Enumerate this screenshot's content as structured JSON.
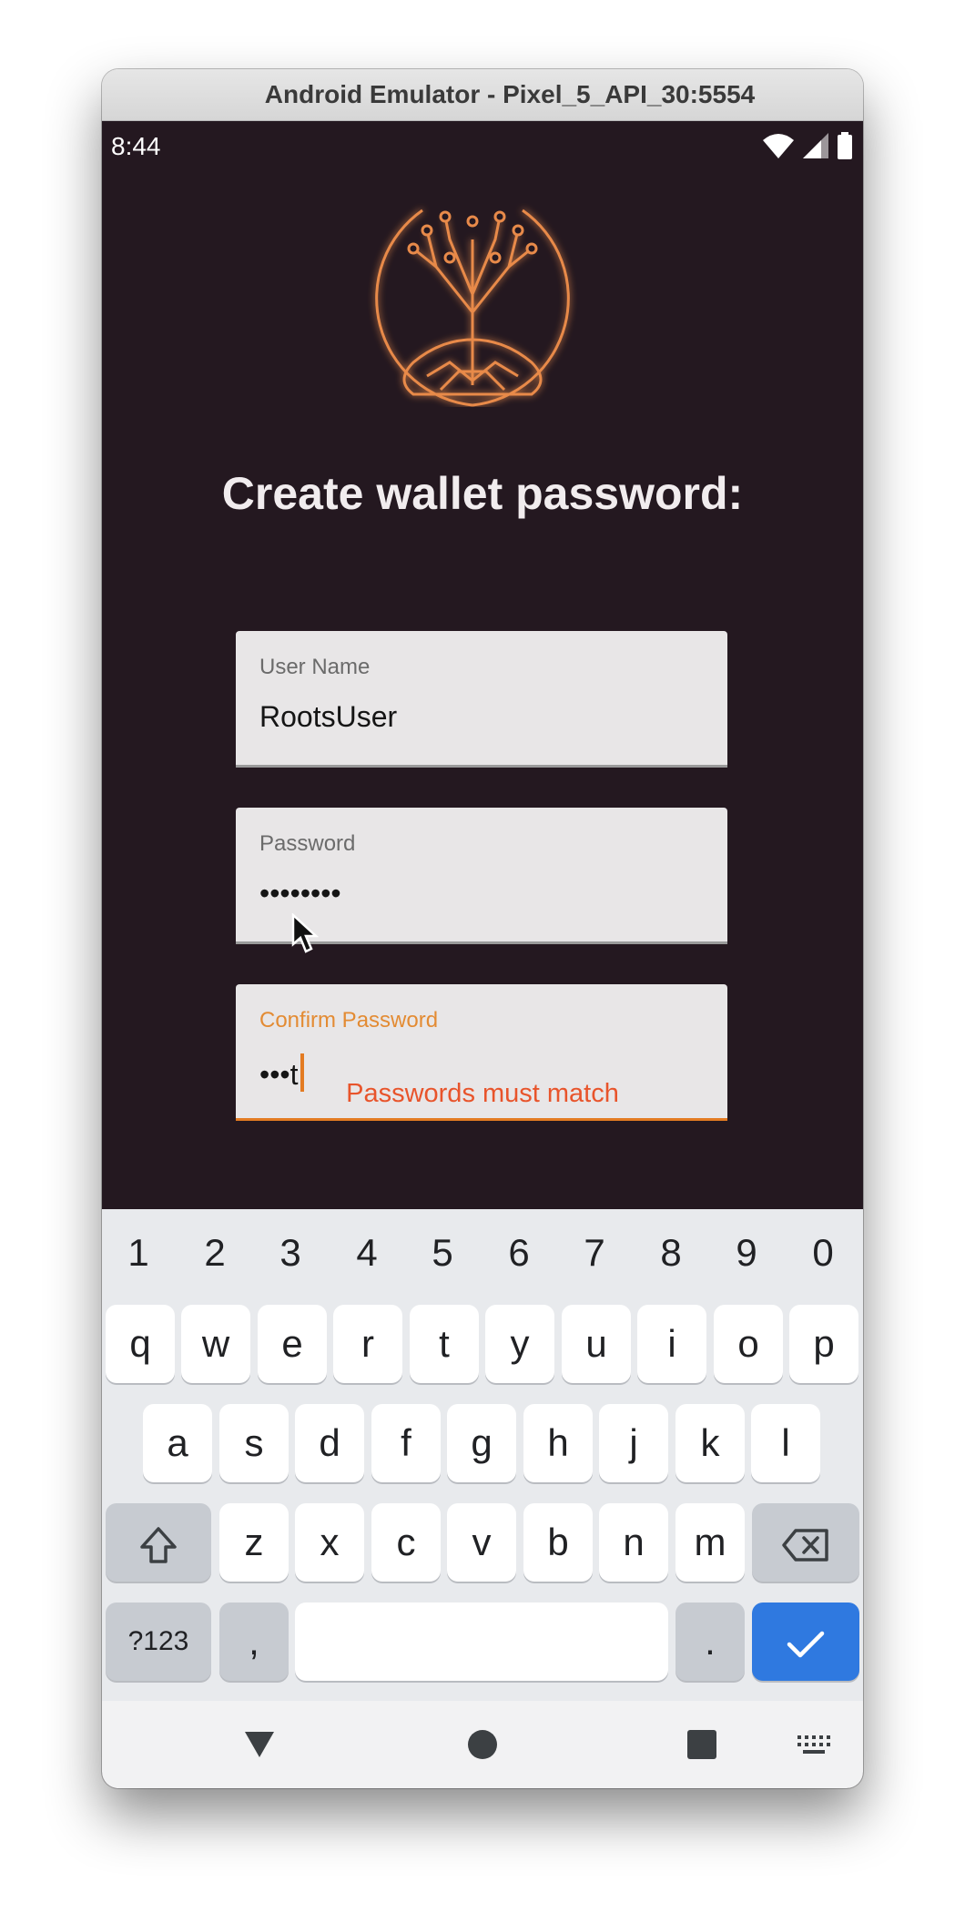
{
  "window": {
    "title": "Android Emulator - Pixel_5_API_30:5554"
  },
  "status_bar": {
    "time": "8:44"
  },
  "heading": "Create wallet password:",
  "fields": {
    "username": {
      "label": "User Name",
      "value": "RootsUser"
    },
    "password": {
      "label": "Password",
      "value": "••••••••"
    },
    "confirm": {
      "label": "Confirm Password",
      "value": "•••t"
    }
  },
  "error_message": "Passwords must match",
  "keyboard": {
    "numbers": [
      "1",
      "2",
      "3",
      "4",
      "5",
      "6",
      "7",
      "8",
      "9",
      "0"
    ],
    "row1": [
      "q",
      "w",
      "e",
      "r",
      "t",
      "y",
      "u",
      "i",
      "o",
      "p"
    ],
    "row2": [
      "a",
      "s",
      "d",
      "f",
      "g",
      "h",
      "j",
      "k",
      "l"
    ],
    "row3": [
      "z",
      "x",
      "c",
      "v",
      "b",
      "n",
      "m"
    ],
    "symbols_label": "?123",
    "comma_label": ",",
    "period_label": "."
  },
  "colors": {
    "background": "#241820",
    "accent": "#e37b22",
    "error": "#e8542b",
    "done_key": "#2f79e0"
  },
  "icons": {
    "logo": "roots-tree-logo",
    "shift": "shift-icon",
    "backspace": "backspace-icon",
    "done": "check-icon",
    "back": "back-triangle-icon",
    "home": "home-circle-icon",
    "recents": "recents-square-icon",
    "keyboard": "keyboard-icon"
  }
}
